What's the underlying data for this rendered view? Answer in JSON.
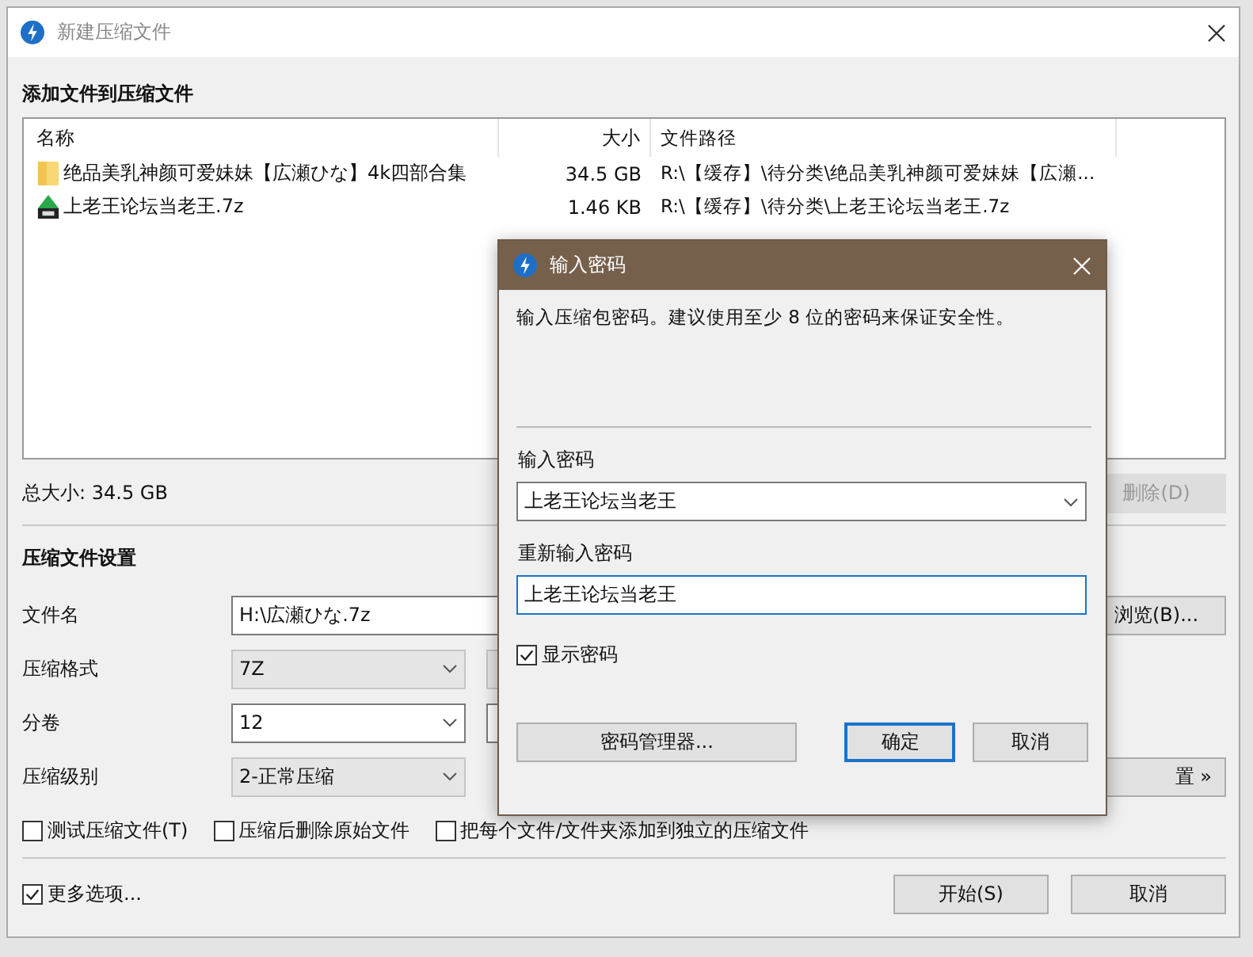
{
  "window": {
    "title": "新建压缩文件"
  },
  "files_section": {
    "heading": "添加文件到压缩文件",
    "columns": [
      "名称",
      "大小",
      "文件路径"
    ],
    "rows": [
      {
        "kind": "folder",
        "name": "绝品美乳神颜可爱妹妹【広瀬ひな】4k四部合集",
        "size": "34.5 GB",
        "path": "R:\\【缓存】\\待分类\\绝品美乳神颜可爱妹妹【広瀬..."
      },
      {
        "kind": "archive",
        "name": "上老王论坛当老王.7z",
        "size": "1.46 KB",
        "path": "R:\\【缓存】\\待分类\\上老王论坛当老王.7z"
      }
    ],
    "total": "总大小: 34.5 GB",
    "delete_button": "删除(D)"
  },
  "settings": {
    "heading": "压缩文件设置",
    "fields": [
      {
        "label": "文件名",
        "kind": "text",
        "value": "H:\\広瀬ひな.7z"
      },
      {
        "label": "压缩格式",
        "kind": "dropdown",
        "value": "7Z"
      },
      {
        "label": "分卷",
        "kind": "combo",
        "value": "12"
      },
      {
        "label": "压缩级别",
        "kind": "dropdown",
        "value": "2-正常压缩"
      }
    ],
    "browse_button": "浏览(B)...",
    "advanced_button": "置 »",
    "options": [
      {
        "label": "测试压缩文件(T)",
        "checked": false
      },
      {
        "label": "压缩后删除原始文件",
        "checked": false
      },
      {
        "label": "把每个文件/文件夹添加到独立的压缩文件",
        "checked": false
      }
    ]
  },
  "more_options": {
    "label": "更多选项...",
    "checked": true
  },
  "buttons": [
    "开始(S)",
    "取消"
  ],
  "password_dialog": {
    "title": "输入密码",
    "message": "输入压缩包密码。建议使用至少 8 位的密码来保证安全性。",
    "password_label": "输入密码",
    "password_value": "上老王论坛当老王",
    "confirm_label": "重新输入密码",
    "confirm_value": "上老王论坛当老王",
    "show_password": {
      "label": "显示密码",
      "checked": true
    },
    "buttons": [
      "密码管理器...",
      "确定",
      "取消"
    ]
  }
}
